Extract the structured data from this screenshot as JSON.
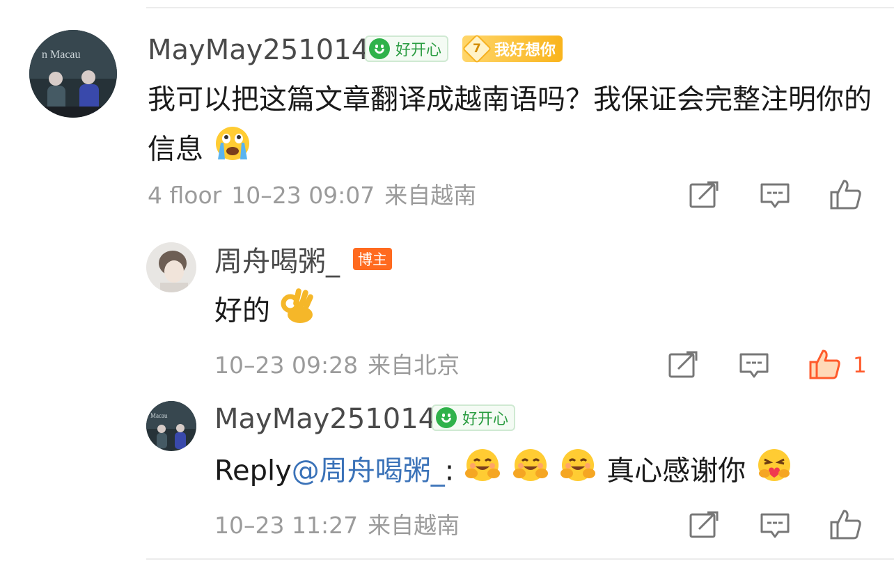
{
  "comments": [
    {
      "user": "MayMay251014",
      "mood_badge": "好开心",
      "fan_badge_level": "7",
      "fan_badge": "我好想你",
      "text": "我可以把这篇文章翻译成越南语吗？我保证会完整注明你的信息",
      "emoji_name": "crying-face-icon",
      "floor": "4 floor",
      "time": "10–23 09:07",
      "location": "来自越南"
    },
    {
      "user": "周舟喝粥_",
      "host_badge": "博主",
      "text": "好的",
      "emoji_name": "ok-hand-icon",
      "time": "10–23 09:28",
      "location": "来自北京",
      "likes": "1"
    },
    {
      "user": "MayMay251014",
      "mood_badge": "好开心",
      "reply_prefix": "Reply",
      "mention": "@周舟喝粥_",
      "colon": ":",
      "text": "真心感谢你",
      "time": "10–23 11:27",
      "location": "来自越南"
    }
  ],
  "colors": {
    "accent_like": "#ff5a2b",
    "mention": "#3a72b8",
    "host_badge": "#ff6a1f",
    "mood_badge": "#2fb24a"
  }
}
